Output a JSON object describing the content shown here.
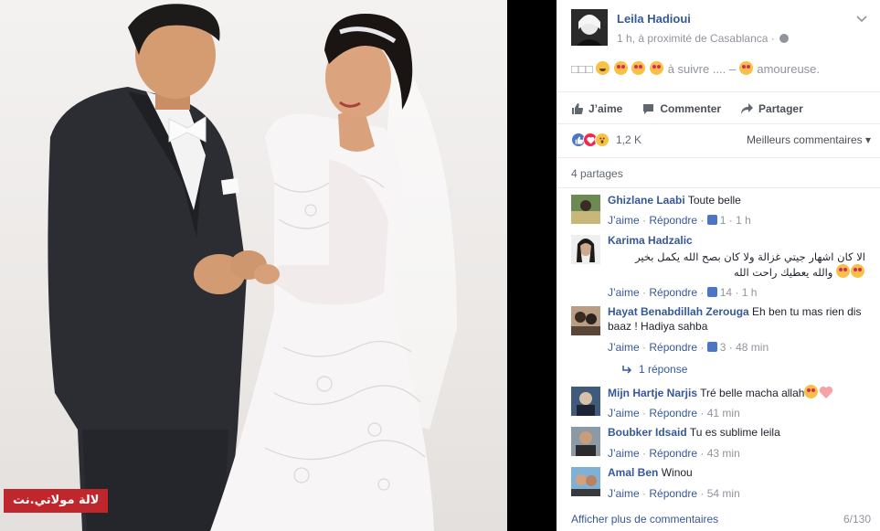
{
  "photo": {
    "watermark": "لالة مولاتي.نت"
  },
  "post": {
    "author": "Leila Hadioui",
    "meta": "1 h, à proximité de Casablanca ·",
    "text_boxes": "□□□",
    "text_middle": " à suivre .... – ",
    "text_end": " amoureuse."
  },
  "actions": {
    "like": "J’aime",
    "comment": "Commenter",
    "share": "Partager"
  },
  "reactions": {
    "count": "1,2 K",
    "best_comments": "Meilleurs commentaires ▾",
    "shares": "4 partages"
  },
  "comments": [
    {
      "name": "Ghizlane Laabi",
      "text": "Toute belle",
      "like": "J’aime",
      "reply": "Répondre",
      "likes": "1",
      "time": "1 h"
    },
    {
      "name": "Karima Hadzalic",
      "text_rtl_1": "الا كان اشهار جيتي غزالة ولا كان بصح الله يكمل بخير",
      "text_rtl_2": "والله يعطيك راحت الله",
      "like": "J’aime",
      "reply": "Répondre",
      "likes": "14",
      "time": "1 h"
    },
    {
      "name": "Hayat Benabdillah Zerouga",
      "text": "Eh ben tu mas rien dis baaz ! Hadiya sahba",
      "like": "J’aime",
      "reply": "Répondre",
      "likes": "3",
      "time": "48 min",
      "replies": "1 réponse"
    },
    {
      "name": "Mijn Hartje Narjis",
      "text": "Tré belle macha allah",
      "like": "J’aime",
      "reply": "Répondre",
      "time": "41 min"
    },
    {
      "name": "Boubker Idsaid",
      "text": "Tu es sublime leila",
      "like": "J’aime",
      "reply": "Répondre",
      "time": "43 min"
    },
    {
      "name": "Amal Ben",
      "text": "Winou",
      "like": "J’aime",
      "reply": "Répondre",
      "time": "54 min"
    }
  ],
  "footer": {
    "more": "Afficher plus de commentaires",
    "pages": "6/130"
  },
  "colors": {
    "link": "#365899",
    "meta": "#90949c",
    "like_blue": "#4e75c4",
    "love_red": "#f0284a",
    "watermark_red": "#c0272d"
  }
}
